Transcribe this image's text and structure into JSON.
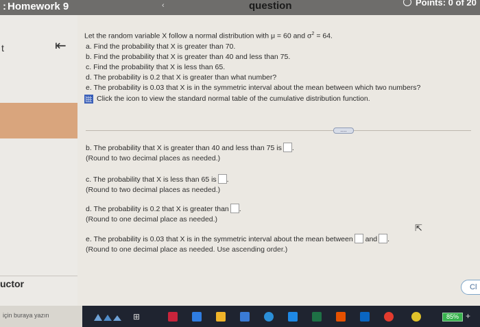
{
  "header": {
    "title": "Homework 9",
    "nav_prev": "‹",
    "question_label": "question",
    "points": "Points: 0 of 20"
  },
  "sidebar": {
    "top_letter": "t",
    "collapse_symbol": "K",
    "instructor_label": "uctor"
  },
  "question": {
    "lead": "Let the random variable X follow a normal distribution with μ = 60 and σ",
    "lead_exp": "2",
    "lead_tail": " = 64.",
    "parts": [
      "a.  Find the probability that X is greater than 70.",
      "b.  Find the probability that X is greater than 40 and less than 75.",
      "c.  Find the probability that X is less than 65.",
      "d.  The probability is 0.2 that X is greater than what number?",
      "e.  The probability is 0.03 that X is in the symmetric interval about the mean between which two numbers?"
    ],
    "table_link": "Click the icon to view the standard normal table of the cumulative distribution function."
  },
  "more_button": "....",
  "answers": {
    "b_text": "b. The probability that X is greater than 40 and less than 75 is",
    "b_hint": "(Round to two decimal places as needed.)",
    "c_text": "c. The probability that X is less than 65 is",
    "c_hint": "(Round to two decimal places as needed.)",
    "d_text": "d. The probability is 0.2 that X is greater than",
    "d_hint": "(Round to one decimal place as needed.)",
    "e_text": "e. The probability is 0.03 that X is in the symmetric interval about the mean between",
    "e_and": "and",
    "e_hint": "(Round to one decimal place as needed. Use ascending order.)"
  },
  "clear_button": "Cl",
  "taskbar": {
    "search_placeholder": "için buraya yazın",
    "battery": "85%"
  }
}
